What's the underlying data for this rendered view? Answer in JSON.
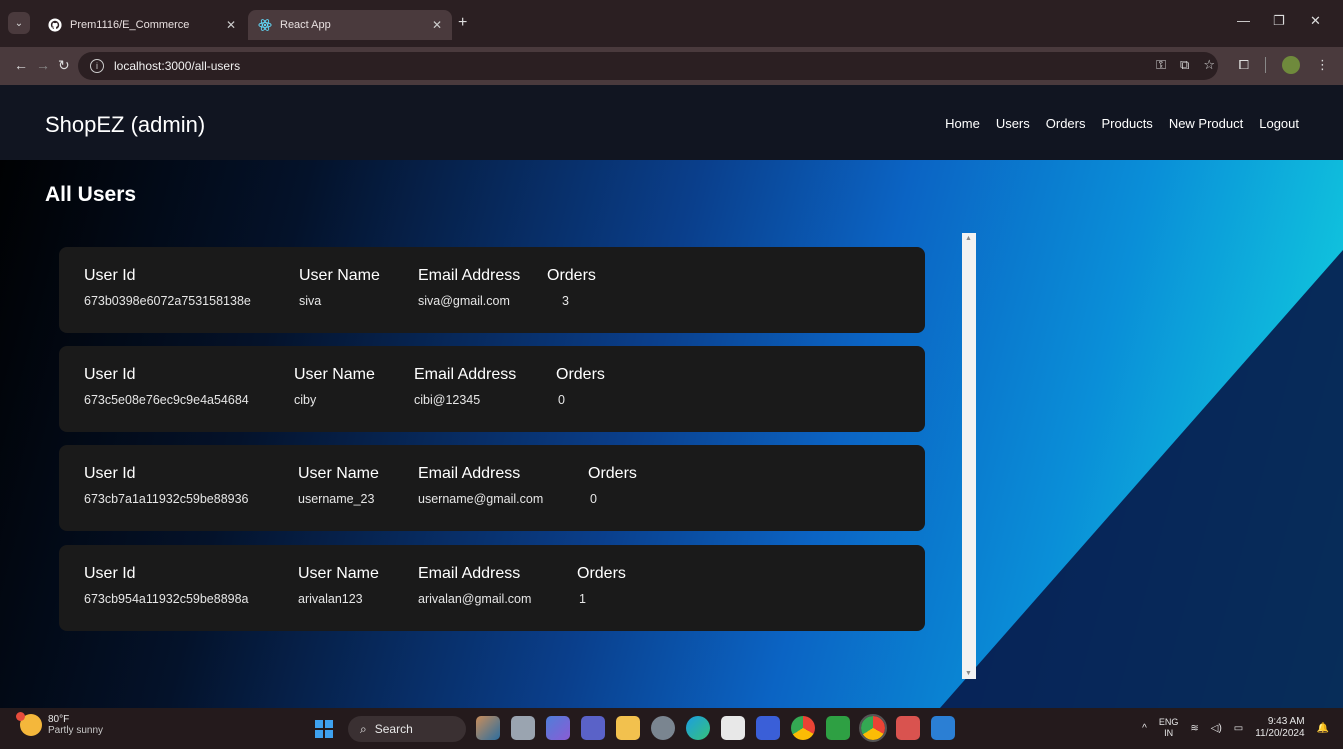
{
  "browser": {
    "tabs": [
      {
        "title": "Prem1116/E_Commerce",
        "icon": "github-icon",
        "active": false
      },
      {
        "title": "React App",
        "icon": "react-icon",
        "active": true
      }
    ],
    "new_tab_label": "+",
    "url": "localhost:3000/all-users"
  },
  "navbar": {
    "brand": "ShopEZ (admin)",
    "links": [
      "Home",
      "Users",
      "Orders",
      "Products",
      "New Product",
      "Logout"
    ]
  },
  "page": {
    "title": "All Users",
    "headers": {
      "id": "User Id",
      "name": "User Name",
      "email": "Email Address",
      "orders": "Orders"
    },
    "users": [
      {
        "id": "673b0398e6072a753158138e",
        "name": "siva",
        "email": "siva@gmail.com",
        "orders": "3"
      },
      {
        "id": "673c5e08e76ec9c9e4a54684",
        "name": "ciby",
        "email": "cibi@12345",
        "orders": "0"
      },
      {
        "id": "673cb7a1a11932c59be88936",
        "name": "username_23",
        "email": "username@gmail.com",
        "orders": "0"
      },
      {
        "id": "673cb954a11932c59be8898a",
        "name": "arivalan123",
        "email": "arivalan@gmail.com",
        "orders": "1"
      }
    ]
  },
  "taskbar": {
    "weather_temp": "80°F",
    "weather_desc": "Partly sunny",
    "search_placeholder": "Search",
    "lang_top": "ENG",
    "lang_bottom": "IN",
    "time": "9:43 AM",
    "date": "11/20/2024"
  },
  "colors": {
    "navbar_bg": "#111521",
    "card_bg": "#1a1a1a",
    "gradient_start": "#000000",
    "gradient_end": "#13dde0"
  }
}
